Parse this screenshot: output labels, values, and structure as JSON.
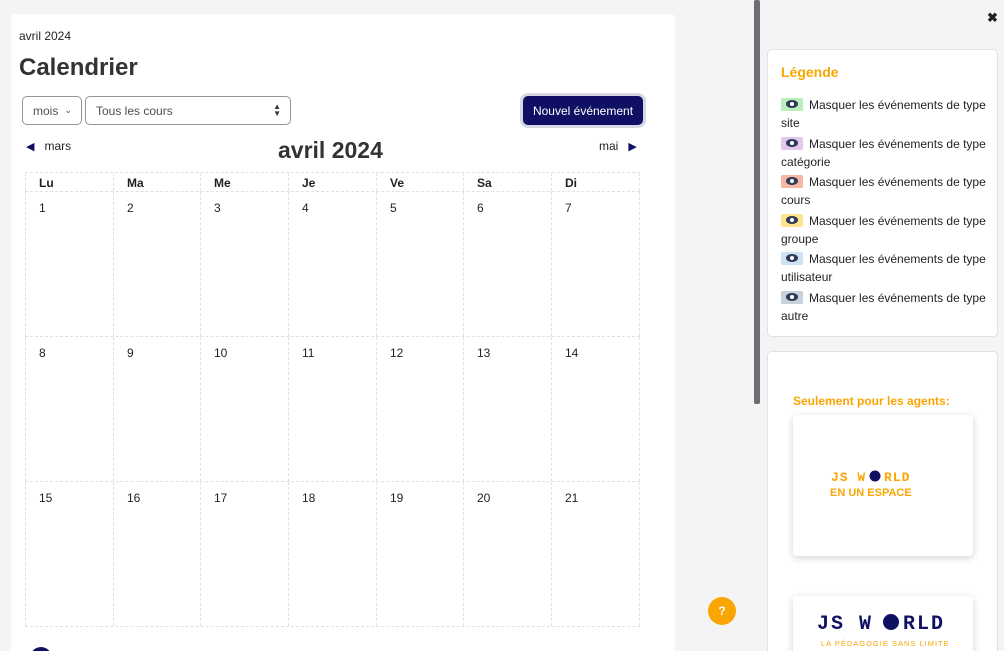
{
  "breadcrumb": "avril 2024",
  "title": "Calendrier",
  "controls": {
    "view_select": "mois",
    "course_select": "Tous les cours",
    "new_event": "Nouvel événement"
  },
  "nav": {
    "prev": "mars",
    "current": "avril 2024",
    "next": "mai"
  },
  "weekdays": [
    "Lu",
    "Ma",
    "Me",
    "Je",
    "Ve",
    "Sa",
    "Di"
  ],
  "weeks": [
    [
      "1",
      "2",
      "3",
      "4",
      "5",
      "6",
      "7"
    ],
    [
      "8",
      "9",
      "10",
      "11",
      "12",
      "13",
      "14"
    ],
    [
      "15",
      "16",
      "17",
      "18",
      "19",
      "20",
      "21"
    ]
  ],
  "help": "?",
  "drawer": {
    "legend_title": "Légende",
    "legend_items": [
      {
        "label": "Masquer les événements de type site",
        "color": "#b8efbd"
      },
      {
        "label": "Masquer les événements de type catégorie",
        "color": "#e3c6ec"
      },
      {
        "label": "Masquer les événements de type cours",
        "color": "#f6b7a4"
      },
      {
        "label": "Masquer les événements de type groupe",
        "color": "#fde48c"
      },
      {
        "label": "Masquer les événements de type utilisateur",
        "color": "#cde2f4"
      },
      {
        "label": "Masquer les événements de type autre",
        "color": "#c7d1dc"
      }
    ],
    "agents_title": "Seulement pour les agents:",
    "logo1": {
      "line1a": "JS W",
      "line1b": "RLD",
      "line2": "EN UN ESPACE"
    },
    "logo2": {
      "line1a": "JS W",
      "line1b": "RLD",
      "line2": "LA PÉDAGOGIE SANS LIMITE"
    }
  },
  "colors": {
    "primary": "#0f1064",
    "accent": "#f9a602"
  }
}
